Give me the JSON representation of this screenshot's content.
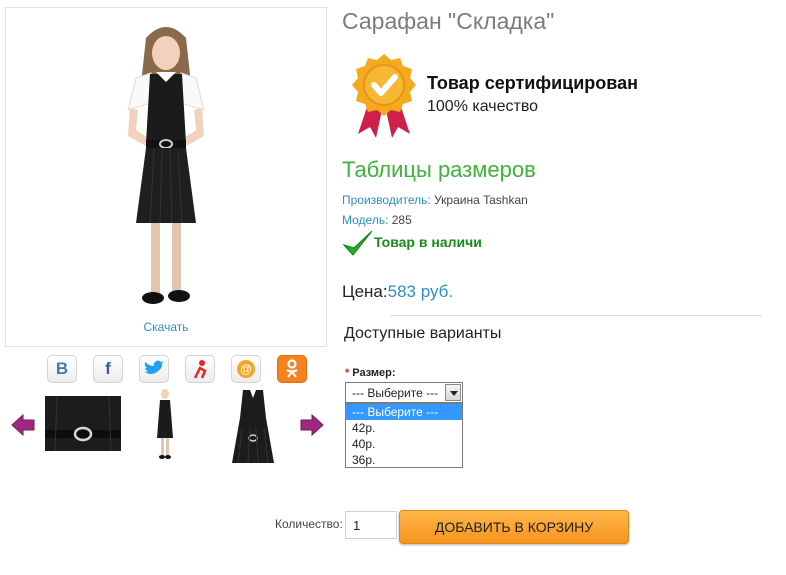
{
  "product": {
    "title": "Сарафан \"Складка\"",
    "download_label": "Скачать",
    "size_table_link": "Таблицы размеров"
  },
  "certificate": {
    "title": "Товар сертифицирован",
    "subtitle": "100% качество",
    "icon": "certified-badge-icon"
  },
  "details": {
    "manufacturer_label": "Производитель:",
    "manufacturer_value": " Украина Tashkan",
    "model_label": "Модель:",
    "model_value": " 285",
    "stock_text": "Товар в наличи"
  },
  "price": {
    "label": "Цена:",
    "value": "583 руб."
  },
  "variants": {
    "title": "Доступные варианты",
    "required_mark": "*",
    "size_label": "Размер:",
    "selected": "--- Выберите ---",
    "options": [
      "--- Выберите ---",
      "42р.",
      "40р.",
      "36р."
    ]
  },
  "share": {
    "icons": [
      "vk-icon",
      "facebook-icon",
      "twitter-icon",
      "moi-mir-icon",
      "mailru-icon",
      "odnoklassniki-icon"
    ],
    "colors": {
      "vk": "#4a76a8",
      "facebook": "#3b5998",
      "twitter": "#1da1f2",
      "moi_mir": "#e8262a",
      "mailru": "#f5a623",
      "ok": "#f58220"
    }
  },
  "cart": {
    "qty_label": "Количество:",
    "qty_value": "1",
    "add_button": "ДОБАВИТЬ В КОРЗИНУ"
  },
  "colors": {
    "accent_blue": "#2d8fc5",
    "size_link_green": "#3fb23a",
    "stock_green": "#1a8a1a",
    "button_orange": "#f7931e",
    "arrow_purple": "#a0287f"
  }
}
